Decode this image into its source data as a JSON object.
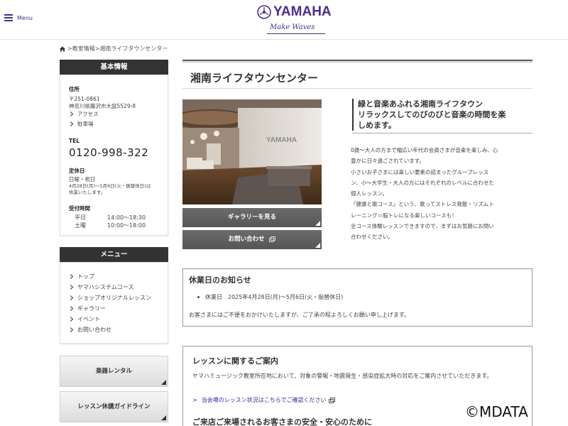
{
  "header": {
    "menu_label": "Menu",
    "brand": "YAMAHA",
    "tagline": "Make Waves"
  },
  "breadcrumb": {
    "items": [
      "教室情報",
      "湘南ライフタウンセンター"
    ],
    "separator": ">"
  },
  "sidebar": {
    "basic_info": {
      "title": "基本情報",
      "address_label": "住所",
      "postal": "〒251-0861",
      "address": "神奈川県藤沢市大庭5529-8",
      "access_link": "アクセス",
      "parking_link": "駐車場",
      "tel_label": "TEL",
      "tel": "0120-998-322",
      "closed_label": "定休日",
      "closed_days": "日曜・祝日",
      "closed_note_1": "4月28日(月)〜5月6日(火・振替休日)は",
      "closed_note_2": "休業いたします。",
      "hours_label": "受付時間",
      "hours": [
        {
          "day": "平日",
          "time": "14:00〜18:30"
        },
        {
          "day": "土曜",
          "time": "10:00〜18:00"
        }
      ]
    },
    "menu": {
      "title": "メニュー",
      "items": [
        "トップ",
        "ヤマハシステムコース",
        "ショップオリジナルレッスン",
        "ギャラリー",
        "イベント",
        "お問い合わせ"
      ]
    },
    "buttons": {
      "rental": "楽器レンタル",
      "guideline": "レッスン休講ガイドライン"
    }
  },
  "main": {
    "title": "湘南ライフタウンセンター",
    "gallery_button": "ギャラリーを見る",
    "contact_button": "お問い合わせ",
    "photo_sign": "YAMAHA",
    "intro_heading": [
      "緑と音楽あふれる湘南ライフタウン",
      "リラックスしてのびのびと音楽の時間を楽",
      "しめます。"
    ],
    "intro_body": [
      "0歳〜大人の方まで幅広い年代の会員さまが音楽を楽しみ、心",
      "豊かに日々過ごされています。",
      "小さいお子さまには楽しい要素の詰まったグループレッス",
      "ン、小〜大学生・大人の方にはそれぞれのレベルに合わせた",
      "個人レッスン。",
      "『健康と歌コース』という、歌ってストレス発散・リズムト",
      "レーニング＝脳トレになる楽しいコースも！",
      "全コース体験レッスンできますので、まずはお気軽にお問い",
      "合わせください。"
    ],
    "notice": {
      "title": "休業日のお知らせ",
      "item": "休業日　2025年4月28日(月)〜5月6日(火・振替休日)",
      "text": "お客さまにはご不便をおかけいたしますが、ご了承の程よろしくお願い申し上げます。"
    },
    "lesson": {
      "title": "レッスンに関するご案内",
      "text": "ヤマハミュージック教室所在地において、対象の警報・地震発生・感染症拡大時の対応をご案内させていただきます。",
      "link": "当会場のレッスン状況はこちらでご確認ください",
      "title2": "ご来店ご来場されるお客さまの安全・安心のために"
    }
  },
  "watermark": "©MDATA",
  "colors": {
    "brand_purple": "#4c2c8c",
    "panel_head": "#333333",
    "dark_button": "#5f5f5f",
    "link": "#3a2a9a"
  }
}
